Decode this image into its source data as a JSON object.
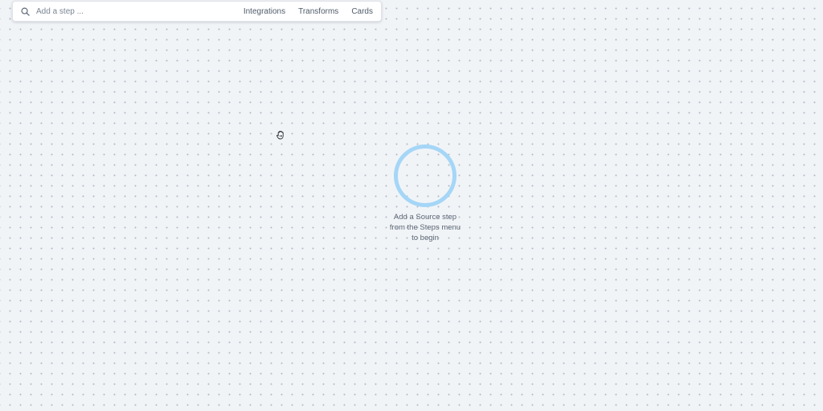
{
  "toolbar": {
    "search_placeholder": "Add a step ...",
    "search_icon": "search-icon",
    "menu": {
      "integrations": "Integrations",
      "transforms": "Transforms",
      "cards": "Cards"
    }
  },
  "canvas": {
    "cursor_icon": "grab-hand-icon",
    "empty_state": {
      "line1": "Add a Source step",
      "line2": "from the Steps menu",
      "line3": "to begin"
    }
  },
  "colors": {
    "background": "#f1f4f7",
    "grid_dot": "#b3bcc6",
    "ring": "#a5d6f7",
    "text": "#5b6675"
  }
}
